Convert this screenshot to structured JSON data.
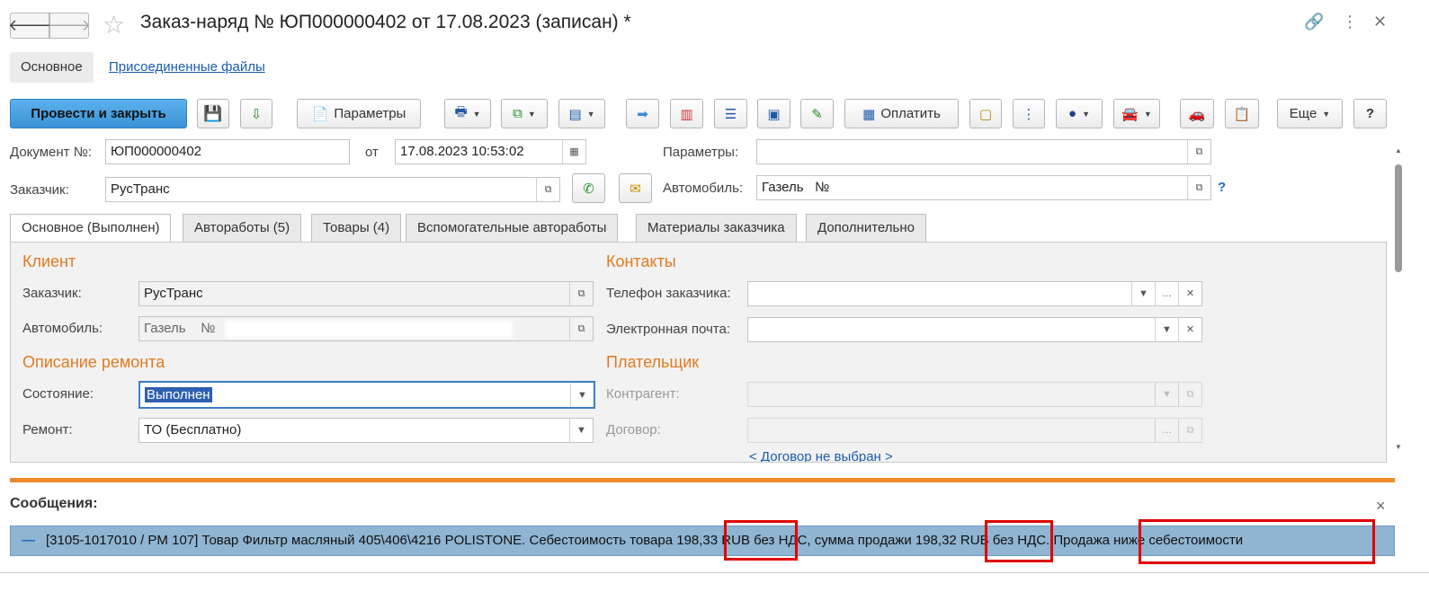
{
  "window": {
    "title": "Заказ-наряд № ЮП000000402 от 17.08.2023 (записан) *",
    "back_icon": "arrow-left-icon",
    "forward_icon": "arrow-right-icon",
    "star_icon": "star-icon",
    "link_icon": "link-icon",
    "more_icon": "more-vertical-icon",
    "close_icon": "close-icon"
  },
  "subtabs": [
    "Основное",
    "Присоединенные файлы"
  ],
  "toolbar": {
    "post_close": "Провести и закрыть",
    "parameters": "Параметры",
    "pay": "Оплатить",
    "more": "Еще",
    "help": "?"
  },
  "header": {
    "doc_no_label": "Документ №:",
    "doc_no": "ЮП000000402",
    "date_from_label": "от",
    "date": "17.08.2023 10:53:02",
    "params_label": "Параметры:",
    "params_value": "",
    "customer_label": "Заказчик:",
    "customer": "РусТранс",
    "car_label": "Автомобиль:",
    "car": "Газель   №",
    "help_q": "?"
  },
  "tabs": [
    "Основное (Выполнен)",
    "Автоработы (5)",
    "Товары (4)",
    "Вспомогательные автоработы",
    "Материалы заказчика",
    "Дополнительно"
  ],
  "client": {
    "section": "Клиент",
    "customer_label": "Заказчик:",
    "customer": "РусТранс",
    "car_label": "Автомобиль:",
    "car": "Газель    №"
  },
  "repair": {
    "section": "Описание ремонта",
    "state_label": "Состояние:",
    "state": "Выполнен",
    "repair_label": "Ремонт:",
    "repair": "ТО (Бесплатно)"
  },
  "contacts": {
    "section": "Контакты",
    "phone_label": "Телефон заказчика:",
    "phone": "",
    "email_label": "Электронная почта:",
    "email": ""
  },
  "payer": {
    "section": "Плательщик",
    "counterparty_label": "Контрагент:",
    "counterparty": "",
    "contract_label": "Договор:",
    "contract": "",
    "contract_link": "< Договор не выбран >"
  },
  "messages": {
    "title": "Сообщения:",
    "text": "[3105-1017010 / PM 107] Товар Фильтр масляный 405\\406\\4216  POLISTONE. Себестоимость товара 198,33 RUB без НДС, сумма продажи 198,32 RUB без НДС. Продажа ниже себестоимости",
    "close": "×",
    "dash": "—"
  },
  "colors": {
    "accent_orange": "#e07a20",
    "primary_blue": "#4aa3e2",
    "message_row": "#8fb5d2",
    "highlight_red": "#e00000"
  }
}
